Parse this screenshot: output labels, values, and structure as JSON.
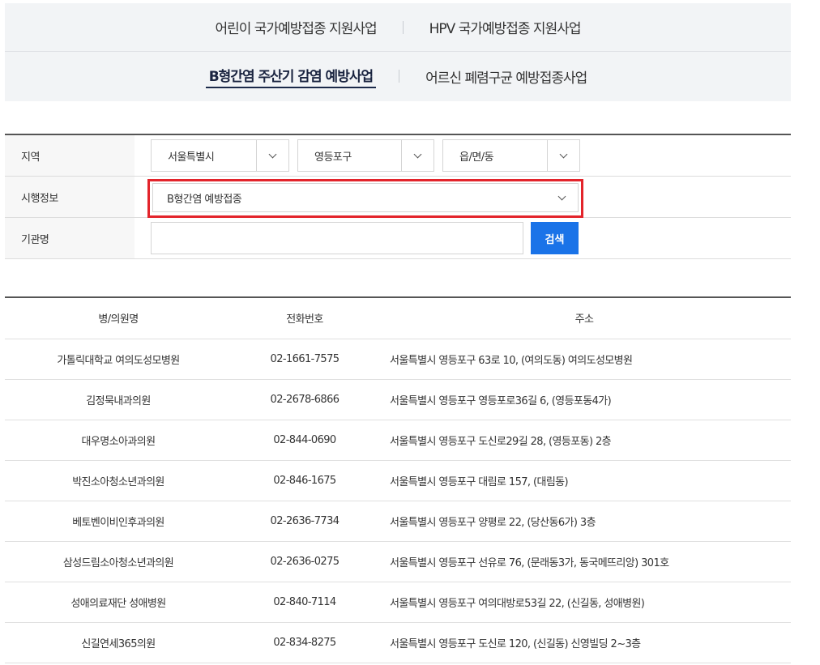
{
  "tabs": {
    "row1": [
      "어린이 국가예방접종 지원사업",
      "HPV 국가예방접종 지원사업"
    ],
    "row2": [
      "B형간염 주산기 감염 예방사업",
      "어르신 폐렴구균 예방접종사업"
    ],
    "active": "B형간염 주산기 감염 예방사업"
  },
  "filter": {
    "region_label": "지역",
    "sido": "서울특별시",
    "gu": "영등포구",
    "dong": "읍/면/동",
    "info_label": "시행정보",
    "info_value": "B형간염 예방접종",
    "name_label": "기관명",
    "name_value": "",
    "search_label": "검색",
    "highlight_color": "#e3242b",
    "button_color": "#1a73e8"
  },
  "table": {
    "headers": [
      "병/의원명",
      "전화번호",
      "주소"
    ],
    "rows": [
      [
        "가톨릭대학교 여의도성모병원",
        "02-1661-7575",
        "서울특별시 영등포구 63로 10, (여의도동) 여의도성모병원"
      ],
      [
        "김정묵내과의원",
        "02-2678-6866",
        "서울특별시 영등포구 영등포로36길 6, (영등포동4가)"
      ],
      [
        "대우명소아과의원",
        "02-844-0690",
        "서울특별시 영등포구 도신로29길 28, (영등포동) 2층"
      ],
      [
        "박진소아청소년과의원",
        "02-846-1675",
        "서울특별시 영등포구 대림로 157, (대림동)"
      ],
      [
        "베토벤이비인후과의원",
        "02-2636-7734",
        "서울특별시 영등포구 양평로 22, (당산동6가) 3층"
      ],
      [
        "삼성드림소아청소년과의원",
        "02-2636-0275",
        "서울특별시 영등포구 선유로 76, (문래동3가, 동국메뜨리앙) 301호"
      ],
      [
        "성애의료재단 성애병원",
        "02-840-7114",
        "서울특별시 영등포구 여의대방로53길 22, (신길동, 성애병원)"
      ],
      [
        "신길연세365의원",
        "02-834-8275",
        "서울특별시 영등포구 도신로 120, (신길동) 신영빌딩 2~3층"
      ]
    ]
  }
}
